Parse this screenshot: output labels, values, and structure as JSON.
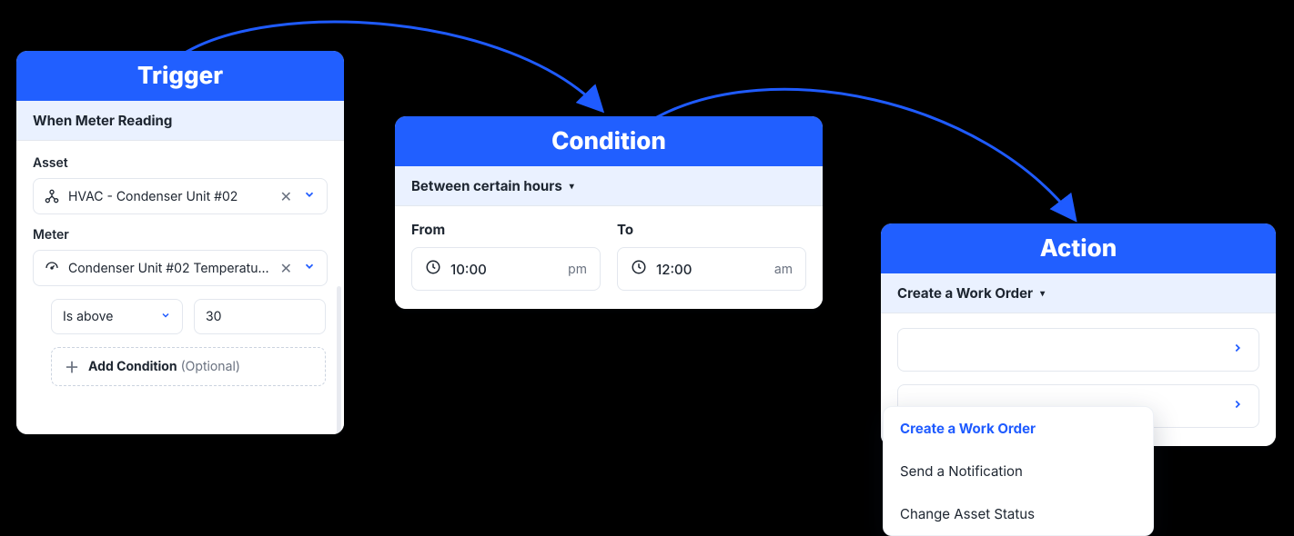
{
  "trigger": {
    "title": "Trigger",
    "subheader": "When Meter Reading",
    "asset_label": "Asset",
    "asset_value": "HVAC - Condenser Unit #02",
    "meter_label": "Meter",
    "meter_value": "Condenser Unit #02 Temperature S…",
    "operator_value": "Is above",
    "threshold_value": "30",
    "add_condition_bold": "Add Condition",
    "add_condition_optional": "(Optional)"
  },
  "condition": {
    "title": "Condition",
    "subheader": "Between certain hours",
    "from_label": "From",
    "from_value": "10:00",
    "from_ampm": "pm",
    "to_label": "To",
    "to_value": "12:00",
    "to_ampm": "am"
  },
  "action": {
    "title": "Action",
    "subheader": "Create a Work Order",
    "rows": [
      {
        "label": ""
      },
      {
        "label": ""
      }
    ],
    "options": [
      "Create a Work Order",
      "Send a Notification",
      "Change Asset Status"
    ]
  },
  "icons": {
    "clear": "✕",
    "chevron_down": "▾",
    "chevron_right": "›",
    "plus": "＋"
  }
}
